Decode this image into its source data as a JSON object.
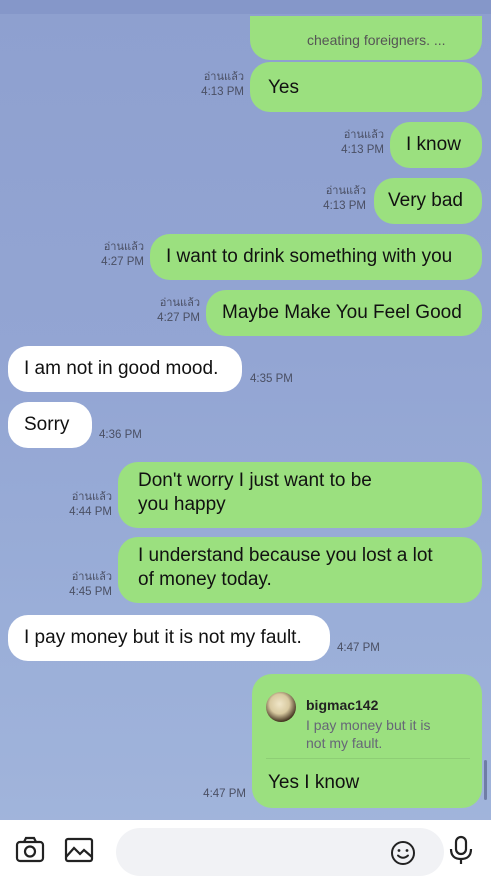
{
  "messages": [
    {
      "text": "cheating foreigners. ..."
    },
    {
      "text": "Yes",
      "read": "อ่านแล้ว",
      "time": "4:13 PM"
    },
    {
      "text": "I know",
      "read": "อ่านแล้ว",
      "time": "4:13 PM"
    },
    {
      "text": "Very bad",
      "read": "อ่านแล้ว",
      "time": "4:13 PM"
    },
    {
      "text": "I want to drink something with you",
      "read": "อ่านแล้ว",
      "time": "4:27 PM"
    },
    {
      "text": "Maybe Make You Feel Good",
      "read": "อ่านแล้ว",
      "time": "4:27 PM"
    },
    {
      "text": "I am not in good mood.",
      "time": "4:35 PM"
    },
    {
      "text": "Sorry",
      "time": "4:36 PM"
    },
    {
      "line1": "Don't worry I just want to be",
      "line2": "you happy",
      "read": "อ่านแล้ว",
      "time": "4:44 PM"
    },
    {
      "line1": "I understand because you lost a lot",
      "line2": "of money today.",
      "read": "อ่านแล้ว",
      "time": "4:45 PM"
    },
    {
      "text": "I pay money but it is not my fault.",
      "time": "4:47 PM"
    },
    {
      "reply_name": "bigmac142",
      "reply_line1": "I pay money but it is",
      "reply_line2": "not my fault.",
      "text": "Yes I know",
      "time": "4:47 PM"
    }
  ],
  "input": {
    "placeholder": ""
  },
  "icons": {
    "camera": "camera-icon",
    "image": "image-icon",
    "emoji": "emoji-icon",
    "mic": "mic-icon"
  },
  "colors": {
    "outgoing": "#9be07f",
    "incoming": "#ffffff",
    "background": "#93a5d3"
  }
}
